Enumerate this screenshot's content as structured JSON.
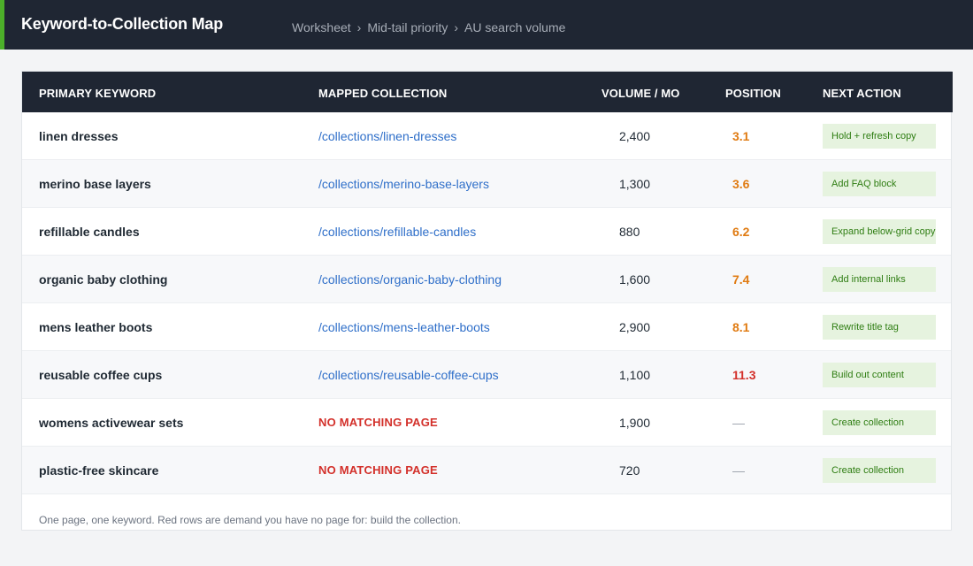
{
  "header": {
    "title": "Keyword-to-Collection Map",
    "breadcrumb": [
      "Worksheet",
      "Mid-tail priority",
      "AU search volume"
    ],
    "separator": "›"
  },
  "table": {
    "columns": [
      "PRIMARY KEYWORD",
      "MAPPED COLLECTION",
      "VOLUME / MO",
      "POSITION",
      "NEXT ACTION"
    ],
    "rows": [
      {
        "keyword": "linen dresses",
        "collection": "/collections/linen-dresses",
        "volume": "2,400",
        "position": "3.1",
        "position_status": "orange",
        "action": "Hold + refresh copy"
      },
      {
        "keyword": "merino base layers",
        "collection": "/collections/merino-base-layers",
        "volume": "1,300",
        "position": "3.6",
        "position_status": "orange",
        "action": "Add FAQ block"
      },
      {
        "keyword": "refillable candles",
        "collection": "/collections/refillable-candles",
        "volume": "880",
        "position": "6.2",
        "position_status": "orange",
        "action": "Expand below-grid copy"
      },
      {
        "keyword": "organic baby clothing",
        "collection": "/collections/organic-baby-clothing",
        "volume": "1,600",
        "position": "7.4",
        "position_status": "orange",
        "action": "Add internal links"
      },
      {
        "keyword": "mens leather boots",
        "collection": "/collections/mens-leather-boots",
        "volume": "2,900",
        "position": "8.1",
        "position_status": "orange",
        "action": "Rewrite title tag"
      },
      {
        "keyword": "reusable coffee cups",
        "collection": "/collections/reusable-coffee-cups",
        "volume": "1,100",
        "position": "11.3",
        "position_status": "red",
        "action": "Build out content"
      },
      {
        "keyword": "womens activewear sets",
        "collection": "NO MATCHING PAGE",
        "collection_missing": true,
        "volume": "1,900",
        "position": "—",
        "position_status": "none",
        "action": "Create collection"
      },
      {
        "keyword": "plastic-free skincare",
        "collection": "NO MATCHING PAGE",
        "collection_missing": true,
        "volume": "720",
        "position": "—",
        "position_status": "none",
        "action": "Create collection"
      }
    ]
  },
  "footnote": "One page, one keyword. Red rows are demand you have no page for: build the collection.",
  "colors": {
    "header_bg": "#1f2633",
    "accent": "#4caf2a",
    "link": "#2f6fc9",
    "position_orange": "#e07b12",
    "position_red": "#d3302a",
    "action_bg": "#e6f3df",
    "action_text": "#2e7d12"
  }
}
